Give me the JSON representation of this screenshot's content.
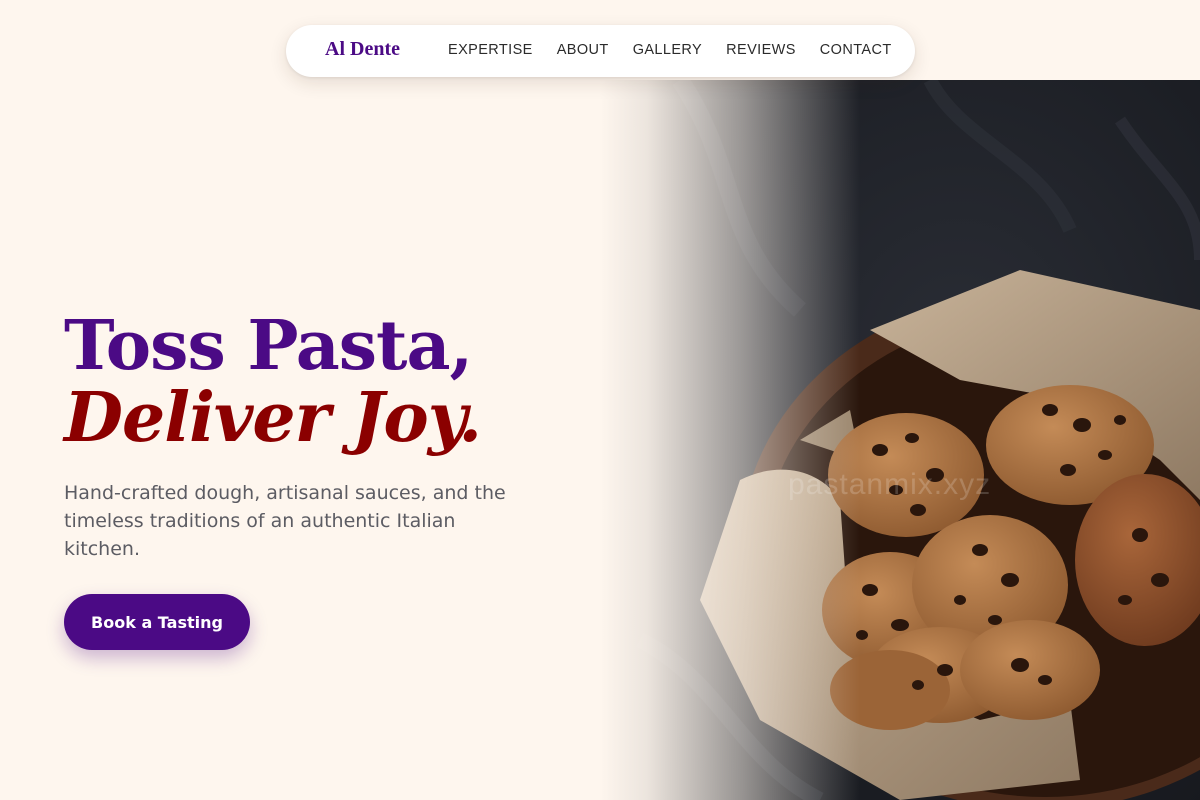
{
  "nav": {
    "brand": "Al Dente",
    "links": [
      "EXPERTISE",
      "ABOUT",
      "GALLERY",
      "REVIEWS",
      "CONTACT"
    ]
  },
  "hero": {
    "headline_line1": "Toss Pasta,",
    "headline_line2": "Deliver Joy.",
    "description": "Hand-crafted dough, artisanal sauces, and the timeless traditions of an authentic Italian kitchen.",
    "cta_label": "Book a Tasting",
    "image_watermark": "pastanmix.xyz"
  },
  "colors": {
    "background": "#fef6ee",
    "brand_purple": "#4b0a85",
    "accent_red": "#8b0000",
    "body_text": "#5c5c63"
  }
}
